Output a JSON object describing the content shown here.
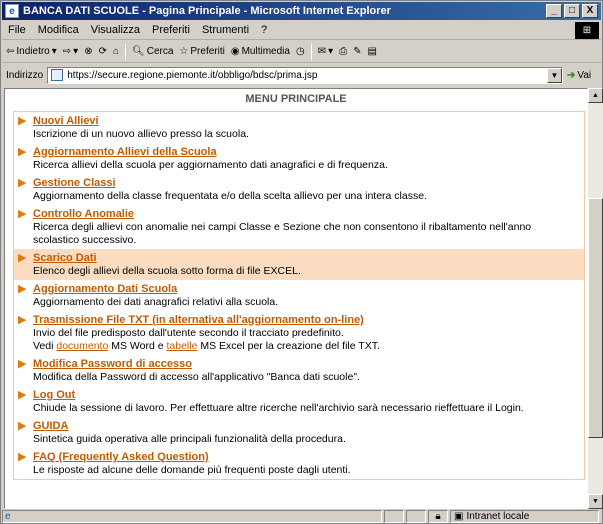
{
  "window": {
    "title": "BANCA DATI SCUOLE - Pagina Principale - Microsoft Internet Explorer",
    "controls": [
      "_",
      "□",
      "X"
    ]
  },
  "menubar": [
    "File",
    "Modifica",
    "Visualizza",
    "Preferiti",
    "Strumenti",
    "?"
  ],
  "toolbar": {
    "back": "Indietro",
    "search": "Cerca",
    "favorites": "Preferiti",
    "multimedia": "Multimedia"
  },
  "address": {
    "label": "Indirizzo",
    "url": "https://secure.regione.piemonte.it/obbligo/bdsc/prima.jsp",
    "go": "Vai"
  },
  "page": {
    "header": "MENU PRINCIPALE",
    "items": [
      {
        "title": "Nuovi Allievi",
        "desc": "Iscrizione di un nuovo allievo presso la scuola."
      },
      {
        "title": "Aggiornamento Allievi della Scuola",
        "desc": "Ricerca allievi della scuola per aggiornamento dati anagrafici e di frequenza."
      },
      {
        "title": "Gestione Classi",
        "desc": "Aggiornamento della classe frequentata e/o della scelta allievo per una intera classe."
      },
      {
        "title": "Controllo Anomalie",
        "desc": "Ricerca degli allievi con anomalie nei campi Classe e Sezione che non consentono il ribaltamento nell'anno scolastico successivo."
      },
      {
        "title": "Scarico Dati",
        "desc": "Elenco degli allievi della scuola sotto forma di file EXCEL."
      },
      {
        "title": "Aggiornamento Dati Scuola",
        "desc": "Aggiornamento dei dati anagrafici relativi alla scuola."
      },
      {
        "title": "Trasmissione File TXT (in alternativa all'aggiornamento on-line)",
        "desc": "Invio del file predisposto dall'utente secondo il tracciato predefinito.",
        "desc2_a": "Vedi ",
        "desc2_link1": "documento",
        "desc2_b": " MS Word e ",
        "desc2_link2": "tabelle",
        "desc2_c": " MS Excel per la creazione del file TXT."
      },
      {
        "title": "Modifica Password di accesso",
        "desc": "Modifica della Password di accesso all'applicativo \"Banca dati scuole\"."
      },
      {
        "title": "Log Out",
        "desc": "Chiude la sessione di lavoro. Per effettuare altre ricerche nell'archivio sarà necessario rieffettuare il Login."
      },
      {
        "title": "GUIDA",
        "desc": "Sintetica guida operativa alle principali funzionalità della procedura."
      },
      {
        "title": "FAQ (Frequently Asked Question)",
        "desc": "Le risposte ad alcune delle domande più frequenti poste dagli utenti."
      }
    ]
  },
  "status": {
    "zone": "Intranet locale"
  }
}
